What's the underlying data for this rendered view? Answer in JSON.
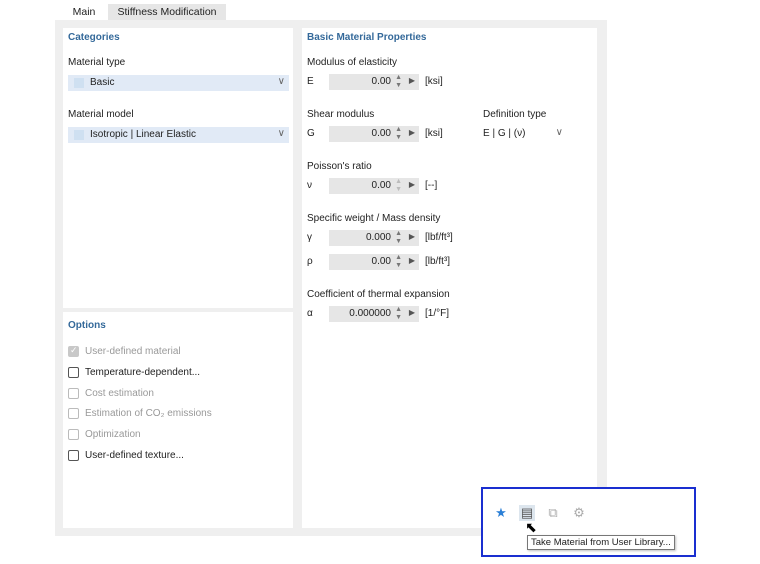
{
  "tabs": [
    "Main",
    "Stiffness Modification"
  ],
  "categories": {
    "title": "Categories",
    "material_type_label": "Material type",
    "material_type_value": "Basic",
    "material_model_label": "Material model",
    "material_model_value": "Isotropic | Linear Elastic"
  },
  "options": {
    "title": "Options",
    "items": [
      {
        "label": "User-defined material",
        "checked": true,
        "enabled": false
      },
      {
        "label": "Temperature-dependent...",
        "checked": false,
        "enabled": true
      },
      {
        "label": "Cost estimation",
        "checked": false,
        "enabled": false
      },
      {
        "label": "Estimation of CO₂ emissions",
        "checked": false,
        "enabled": false
      },
      {
        "label": "Optimization",
        "checked": false,
        "enabled": false
      },
      {
        "label": "User-defined texture...",
        "checked": false,
        "enabled": true
      }
    ]
  },
  "props": {
    "title": "Basic Material Properties",
    "modulus_label": "Modulus of elasticity",
    "E": {
      "symbol": "E",
      "value": "0.00",
      "unit": "[ksi]"
    },
    "shear_label": "Shear modulus",
    "G": {
      "symbol": "G",
      "value": "0.00",
      "unit": "[ksi]"
    },
    "definition_type_label": "Definition type",
    "definition_type_value": "E | G | (ν)",
    "poisson_label": "Poisson's ratio",
    "nu": {
      "symbol": "ν",
      "value": "0.00",
      "unit": "[--]"
    },
    "weight_label": "Specific weight / Mass density",
    "gamma": {
      "symbol": "γ",
      "value": "0.000",
      "unit": "[lbf/ft³]"
    },
    "rho": {
      "symbol": "ρ",
      "value": "0.00",
      "unit": "[lb/ft³]"
    },
    "thermal_label": "Coefficient of thermal expansion",
    "alpha": {
      "symbol": "α",
      "value": "0.000000",
      "unit": "[1/°F]"
    }
  },
  "toolbar": {
    "tooltip": "Take Material from User Library...",
    "icons": [
      "add-favorite-icon",
      "user-library-icon",
      "export-icon",
      "settings-icon"
    ]
  }
}
